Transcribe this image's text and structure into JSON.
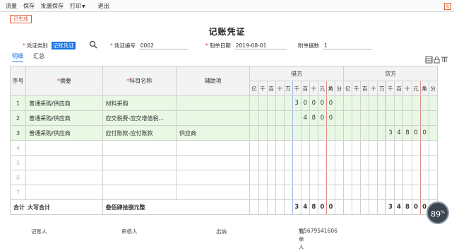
{
  "menu": {
    "items": [
      "流量",
      "保存",
      "批量保存",
      "打印",
      "退出"
    ],
    "corner": "k"
  },
  "status_badge": "已生成",
  "title": "记账凭证",
  "form": {
    "type_label": "凭证类别",
    "type_value": "记账凭证",
    "number_label": "凭证编号",
    "number_value": "0002",
    "date_label": "制单日期",
    "date_value": "2019-08-01",
    "attach_label": "附单据数",
    "attach_value": "1"
  },
  "tabs": [
    "明细",
    "汇总"
  ],
  "table": {
    "headers": {
      "seq": "序号",
      "summary": "摘要",
      "account": "科目名称",
      "aux": "辅助项",
      "debit": "借方",
      "credit": "贷方",
      "digits": [
        "亿",
        "千",
        "百",
        "十",
        "万",
        "千",
        "百",
        "十",
        "元",
        "角",
        "分"
      ]
    },
    "rows": [
      {
        "seq": "1",
        "summary": "普通采购/供应商",
        "account": "材料采购",
        "aux": "",
        "debit": [
          "",
          "",
          "",
          "",
          "",
          "3",
          "0",
          "0",
          "0",
          "0",
          ""
        ],
        "credit": [
          "",
          "",
          "",
          "",
          "",
          "",
          "",
          "",
          "",
          "",
          ""
        ]
      },
      {
        "seq": "2",
        "summary": "普通采购/供应商",
        "account": "应交税费-应交增值税...",
        "aux": "",
        "debit": [
          "",
          "",
          "",
          "",
          "",
          "",
          "4",
          "8",
          "0",
          "0",
          ""
        ],
        "credit": [
          "",
          "",
          "",
          "",
          "",
          "",
          "",
          "",
          "",
          "",
          ""
        ]
      },
      {
        "seq": "3",
        "summary": "普通采购/供应商",
        "account": "应付账款-应付账款",
        "aux": "供应商",
        "debit": [
          "",
          "",
          "",
          "",
          "",
          "",
          "",
          "",
          "",
          "",
          ""
        ],
        "credit": [
          "",
          "",
          "",
          "",
          "",
          "3",
          "4",
          "8",
          "0",
          "0",
          ""
        ]
      }
    ],
    "empty_rows": [
      "4",
      "5",
      "6",
      "7"
    ],
    "total": {
      "label": "合计",
      "caps_label": "大写合计",
      "caps_value": "叁佰肆拾捌元整",
      "debit": [
        "",
        "",
        "",
        "",
        "",
        "3",
        "4",
        "8",
        "0",
        "0",
        ""
      ],
      "credit": [
        "",
        "",
        "",
        "",
        "",
        "3",
        "4",
        "8",
        "0",
        "0",
        ""
      ]
    }
  },
  "footer": {
    "bookkeeper": "记账人",
    "auditor": "审核人",
    "cashier": "出纳",
    "maker_label": "制单人",
    "maker_value": "15679541606"
  },
  "float_badge": {
    "value": "89",
    "unit": "%"
  }
}
